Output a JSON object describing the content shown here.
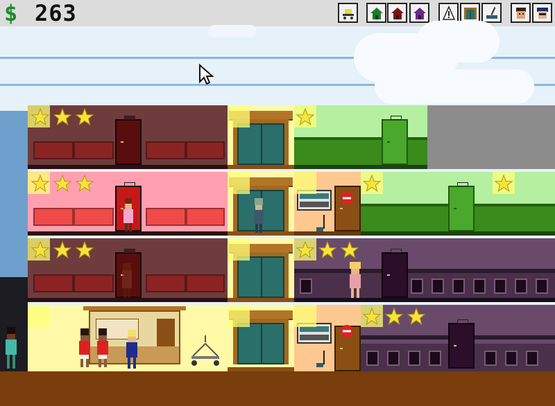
{
  "hud": {
    "money_symbol": "$",
    "money": "263"
  },
  "toolbar": {
    "buttons": [
      {
        "name": "build-lobby-button",
        "icon": "bell-cart-icon"
      },
      {
        "name": "build-green-room-button",
        "icon": "green-house-icon"
      },
      {
        "name": "build-red-room-button",
        "icon": "red-house-icon"
      },
      {
        "name": "build-purple-room-button",
        "icon": "purple-house-icon"
      },
      {
        "name": "build-caution-button",
        "icon": "warning-sign-icon"
      },
      {
        "name": "build-elevator-button",
        "icon": "elevator-icon"
      },
      {
        "name": "build-service-button",
        "icon": "mop-icon"
      },
      {
        "name": "hire-staff-button",
        "icon": "staff-face-icon"
      },
      {
        "name": "hire-manager-button",
        "icon": "manager-face-icon"
      }
    ]
  },
  "colors": {
    "room_dark_red": "#6e3c3c",
    "room_pink": "#ff9fb0",
    "room_green": "#b4f0a0",
    "room_purple": "#6a4a6a",
    "lobby_yellow": "#fff9a8",
    "utility_orange": "#ffc890",
    "ground": "#7a3d0c",
    "star": "#f6e43a"
  },
  "floors": [
    {
      "room_a_stars": 3,
      "room_b_stars": 1
    },
    {
      "room_a_stars": 3,
      "room_b_stars": 1,
      "room_c_stars": 1
    },
    {
      "room_a_stars": 3,
      "room_b_stars": 3
    },
    {
      "room_b_stars": 3
    }
  ]
}
